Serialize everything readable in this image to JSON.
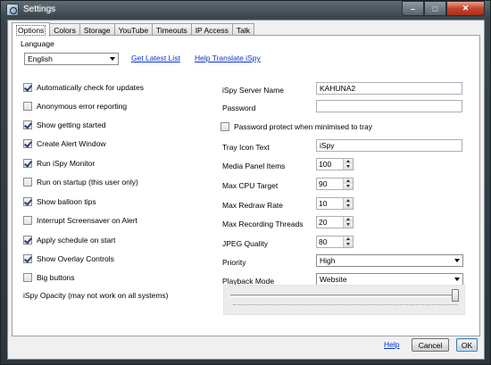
{
  "window": {
    "title": "Settings"
  },
  "tabs": [
    "Options",
    "Colors",
    "Storage",
    "YouTube",
    "Timeouts",
    "IP Access",
    "Talk"
  ],
  "language": {
    "group_label": "Language",
    "selected": "English",
    "get_latest_link": "Get Latest List",
    "help_translate_link": "Help Translate iSpy"
  },
  "left_options": [
    {
      "label": "Automatically check for updates",
      "checked": true
    },
    {
      "label": "Anonymous error reporting",
      "checked": false
    },
    {
      "label": "Show getting started",
      "checked": true
    },
    {
      "label": "Create Alert Window",
      "checked": true
    },
    {
      "label": "Run iSpy Monitor",
      "checked": true
    },
    {
      "label": "Run on startup (this user only)",
      "checked": false
    },
    {
      "label": "Show balloon tips",
      "checked": true
    },
    {
      "label": "Interrupt Screensaver on Alert",
      "checked": false
    },
    {
      "label": "Apply schedule on start",
      "checked": true
    },
    {
      "label": "Show Overlay Controls",
      "checked": true
    },
    {
      "label": "Big buttons",
      "checked": false
    }
  ],
  "server": {
    "name_label": "iSpy Server Name",
    "name_value": "KAHUNA2",
    "password_label": "Password",
    "password_value": "",
    "protect_label": "Password protect when minimised to tray",
    "protect_checked": false
  },
  "tray": {
    "label": "Tray Icon Text",
    "value": "iSpy"
  },
  "numeric_settings": [
    {
      "label": "Media Panel Items",
      "value": "100"
    },
    {
      "label": "Max CPU Target",
      "value": "90"
    },
    {
      "label": "Max Redraw Rate",
      "value": "10"
    },
    {
      "label": "Max Recording Threads",
      "value": "20"
    },
    {
      "label": "JPEG Quality",
      "value": "80"
    }
  ],
  "priority": {
    "label": "Priority",
    "value": "High"
  },
  "playback": {
    "label": "Playback Mode",
    "value": "Website"
  },
  "opacity": {
    "label": "iSpy Opacity (may not work on all systems)",
    "level": 1.0
  },
  "footer": {
    "help": "Help",
    "cancel": "Cancel",
    "ok": "OK"
  },
  "colors": {
    "link": "#0b32c9",
    "check": "#2c3f7a",
    "frame": "#2c363c"
  }
}
